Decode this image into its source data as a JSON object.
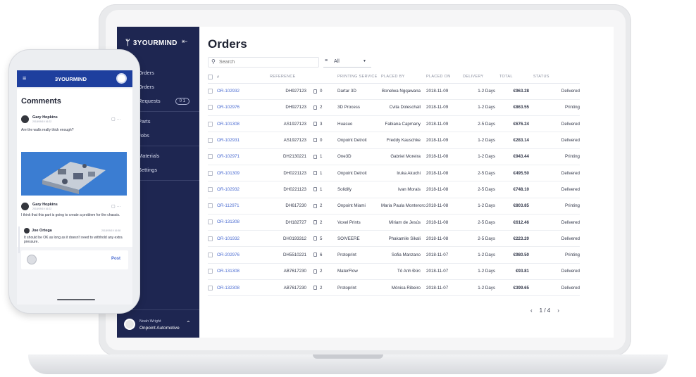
{
  "sidebar": {
    "brand": "3YOURMIND",
    "items": [
      {
        "label": "Orders"
      },
      {
        "label": "Orders"
      },
      {
        "label": "Requests",
        "badge": "0 1"
      },
      {
        "label": "Parts"
      },
      {
        "label": "Jobs"
      },
      {
        "label": "Materials"
      },
      {
        "label": "Settings"
      }
    ],
    "user": {
      "name": "Noah Wright",
      "company": "Onpoint Automotive"
    }
  },
  "main": {
    "title": "Orders",
    "search_placeholder": "Search",
    "filter_label": "All",
    "columns": [
      "#",
      "REFERENCE",
      "",
      "PRINTING SERVICE",
      "PLACED BY",
      "PLACED ON",
      "DELIVERY",
      "TOTAL",
      "STATUS"
    ],
    "rows": [
      {
        "id": "OR-102932",
        "ref": "DH927123",
        "files": "0",
        "service": "Dartar 3D",
        "placed_by": "Bonelwa Ngqawana",
        "placed_on": "2018-11-09",
        "delivery": "1-2 Days",
        "total": "€963.28",
        "status": "Delivered"
      },
      {
        "id": "OR-102976",
        "ref": "DH927123",
        "files": "2",
        "service": "3D Process",
        "placed_by": "Cvita Doleschall",
        "placed_on": "2018-11-09",
        "delivery": "1-2 Days",
        "total": "€863.55",
        "status": "Printing"
      },
      {
        "id": "OR-101308",
        "ref": "AS1927123",
        "files": "3",
        "service": "Huasuo",
        "placed_by": "Fabiana Capmany",
        "placed_on": "2018-11-09",
        "delivery": "2-5 Days",
        "total": "€676.24",
        "status": "Delivered"
      },
      {
        "id": "OR-102931",
        "ref": "AS1927123",
        "files": "0",
        "service": "Onpoint Detroit",
        "placed_by": "Freddy Kauschke",
        "placed_on": "2018-11-09",
        "delivery": "1-2 Days",
        "total": "€283.14",
        "status": "Delivered"
      },
      {
        "id": "OR-102971",
        "ref": "DH2130221",
        "files": "1",
        "service": "One3D",
        "placed_by": "Gabriel Moreira",
        "placed_on": "2018-11-08",
        "delivery": "1-2 Days",
        "total": "€943.44",
        "status": "Printing"
      },
      {
        "id": "OR-101309",
        "ref": "DH0221123",
        "files": "1",
        "service": "Onpoint Detroit",
        "placed_by": "Iruka Akuchi",
        "placed_on": "2018-11-08",
        "delivery": "2-5 Days",
        "total": "€495.50",
        "status": "Delivered"
      },
      {
        "id": "OR-102932",
        "ref": "DH0221123",
        "files": "1",
        "service": "Solidify",
        "placed_by": "Ivan Morais",
        "placed_on": "2018-11-08",
        "delivery": "2-5 Days",
        "total": "€748.10",
        "status": "Delivered"
      },
      {
        "id": "OR-112971",
        "ref": "DH617230",
        "files": "2",
        "service": "Onpoint Miami",
        "placed_by": "Maria Paula Monteroro",
        "placed_on": "2018-11-08",
        "delivery": "1-2 Days",
        "total": "€803.85",
        "status": "Printing"
      },
      {
        "id": "OR-131308",
        "ref": "DH182727",
        "files": "2",
        "service": "Voxel Prints",
        "placed_by": "Miriam de Jesús",
        "placed_on": "2018-11-08",
        "delivery": "2-5 Days",
        "total": "€612.46",
        "status": "Delivered"
      },
      {
        "id": "OR-101932",
        "ref": "DH0193312",
        "files": "5",
        "service": "SOIVEERE",
        "placed_by": "Phakamile Sikali",
        "placed_on": "2018-11-08",
        "delivery": "2-5 Days",
        "total": "€223.20",
        "status": "Delivered"
      },
      {
        "id": "OR-202976",
        "ref": "DH5510221",
        "files": "6",
        "service": "Protoprint",
        "placed_by": "Sofia Manzano",
        "placed_on": "2018-11-07",
        "delivery": "1-2 Days",
        "total": "€980.50",
        "status": "Printing"
      },
      {
        "id": "OR-131308",
        "ref": "AB7617230",
        "files": "2",
        "service": "MaterFlow",
        "placed_by": "Tô Anh Đức",
        "placed_on": "2018-11-07",
        "delivery": "1-2 Days",
        "total": "€93.81",
        "status": "Delivered"
      },
      {
        "id": "OR-132308",
        "ref": "AB7617230",
        "files": "2",
        "service": "Protoprint",
        "placed_by": "Mónica Ribeiro",
        "placed_on": "2018-11-07",
        "delivery": "1-2 Days",
        "total": "€399.65",
        "status": "Delivered"
      }
    ],
    "pager": {
      "prev": "‹",
      "page": "1 / 4",
      "next": "›"
    }
  },
  "phone": {
    "brand": "3YOURMIND",
    "title": "Comments",
    "comments": [
      {
        "author": "Gary Hopkins",
        "date": "2018/09/19 16:22",
        "text": "Are the walls really thick enough?"
      },
      {
        "author": "Gary Hopkins",
        "date": "2018/09/19 16:22",
        "text": "I think that this part is going to create a problem for the chassis."
      },
      {
        "author": "Joe Ortega",
        "date": "2018/09/19 16:58",
        "text": "It should be OK as long as it doesn't need to withhold any extra pressure."
      }
    ],
    "post_label": "Post"
  }
}
